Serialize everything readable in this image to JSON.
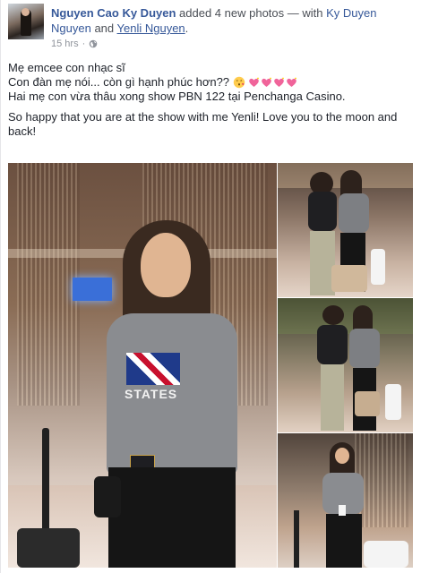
{
  "post": {
    "author": "Nguyen Cao Ky Duyen",
    "action": "added 4 new photos",
    "with_sep": "— with",
    "tagged1": "Ky Duyen Nguyen",
    "and": "and",
    "tagged2": "Yenli Nguyen",
    "period": ".",
    "time": "15 hrs",
    "dot": "·",
    "privacy_icon": "globe-icon",
    "text": {
      "line1": "Mẹ emcee con nhạc sĩ",
      "line2": "Con đàn mẹ nói... còn gì hạnh phúc hơn??",
      "line3": "Hai mẹ con vừa thâu xong show PBN 122 tại Penchanga Casino.",
      "para2": "So happy that you are at the show with me Yenli! Love you to the moon and back!"
    },
    "emoji": [
      "kissing-face-icon",
      "sparkling-heart-icon",
      "sparkling-heart-icon",
      "sparkling-heart-icon",
      "sparkling-heart-icon"
    ],
    "photos": {
      "count": 4,
      "main_shirt_text": "STATES"
    }
  },
  "colors": {
    "link": "#365899",
    "meta": "#90949c",
    "text": "#1d2129",
    "heart": "#f0649a"
  }
}
